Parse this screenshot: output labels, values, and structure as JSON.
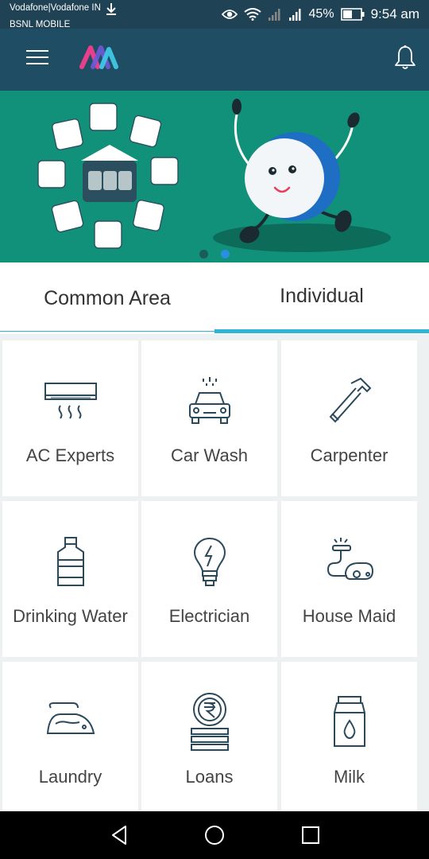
{
  "status_bar": {
    "carrier_line1": "Vodafone|Vodafone IN",
    "carrier_line2": "BSNL MOBILE",
    "battery_percent": "45%",
    "time": "9:54 am"
  },
  "app_bar": {
    "menu_icon": "hamburger-icon",
    "logo_icon": "app-logo",
    "notification_icon": "bell-icon"
  },
  "banner": {
    "active_slide_index": 1,
    "slide_count": 2
  },
  "tabs": [
    {
      "label": "Common Area",
      "selected": false
    },
    {
      "label": "Individual",
      "selected": true
    }
  ],
  "services": [
    {
      "label": "AC Experts",
      "icon": "air-conditioner-icon"
    },
    {
      "label": "Car Wash",
      "icon": "car-wash-icon"
    },
    {
      "label": "Carpenter",
      "icon": "hammer-icon"
    },
    {
      "label": "Drinking Water",
      "icon": "water-bottle-icon"
    },
    {
      "label": "Electrician",
      "icon": "bulb-icon"
    },
    {
      "label": "House Maid",
      "icon": "vacuum-icon"
    },
    {
      "label": "Laundry",
      "icon": "iron-icon"
    },
    {
      "label": "Loans",
      "icon": "rupee-coins-icon"
    },
    {
      "label": "Milk",
      "icon": "milk-carton-icon"
    }
  ],
  "colors": {
    "app_bar": "#1f4d63",
    "banner": "#11907a",
    "accent": "#2fb4d3",
    "icon_stroke": "#2a4a5c"
  }
}
